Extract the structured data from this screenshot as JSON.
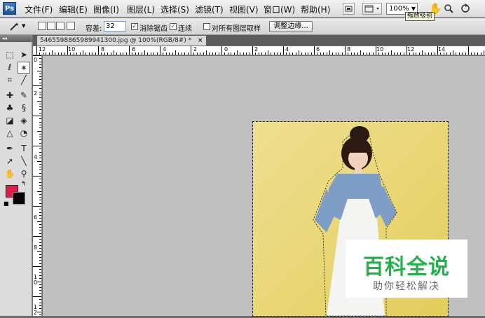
{
  "app": {
    "logo": "Ps"
  },
  "menu": [
    "文件(F)",
    "编辑(E)",
    "图像(I)",
    "图层(L)",
    "选择(S)",
    "滤镜(T)",
    "视图(V)",
    "窗口(W)",
    "帮助(H)"
  ],
  "menubar": {
    "zoom_value": "100%",
    "tooltip": "缩放级别",
    "icons": [
      "bridge-icon",
      "screen-mode-icon",
      "hand-icon",
      "zoom-icon",
      "rotate-icon"
    ]
  },
  "options": {
    "tolerance_label": "容差:",
    "tolerance_value": "32",
    "antialias_label": "消除锯齿",
    "antialias_checked": true,
    "contiguous_label": "连续",
    "contiguous_checked": true,
    "sample_all_label": "对所有图层取样",
    "sample_all_checked": false,
    "refine_edge_button": "调整边缘..."
  },
  "document": {
    "tab_title": "5465598865989941300.jpg @ 100%(RGB/8#) *",
    "close": "×"
  },
  "ruler_top_labels": [
    "12",
    "10",
    "8",
    "6",
    "4",
    "2",
    "0",
    "2",
    "4",
    "6",
    "8",
    "10",
    "12",
    "14"
  ],
  "ruler_left_labels": [
    "0",
    "2",
    "4",
    "6",
    "8",
    "1 0",
    "1 2"
  ],
  "colors": {
    "foreground": "#e8194a",
    "background": "#000000"
  },
  "watermark": {
    "title": "百科全说",
    "subtitle": "助你轻松解决"
  }
}
